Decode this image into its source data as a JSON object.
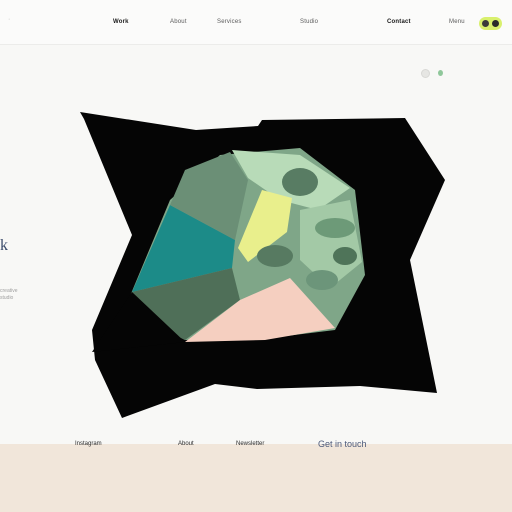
{
  "header": {
    "logo": "·",
    "nav": [
      {
        "label": "Work"
      },
      {
        "label": "About"
      },
      {
        "label": "Services"
      },
      {
        "label": "Studio"
      },
      {
        "label": "Contact"
      },
      {
        "label": "Menu"
      }
    ],
    "theme_toggle_state": "on"
  },
  "hero": {
    "title": "k",
    "subtitle_lines": [
      "creative",
      "studio"
    ]
  },
  "carousel": {
    "slides": 2,
    "active_index": 1
  },
  "footer": {
    "links": [
      "Instagram",
      "About",
      "Newsletter"
    ],
    "cta": "Get in touch"
  },
  "colors": {
    "accent_toggle": "#d9f06d",
    "footer_bg": "#f1e6da",
    "art_dark": "#050505",
    "art_teal": "#1c8b88",
    "art_green": "#7fa688",
    "art_pink": "#f5cfc0",
    "art_yellow": "#e9ef8c"
  }
}
